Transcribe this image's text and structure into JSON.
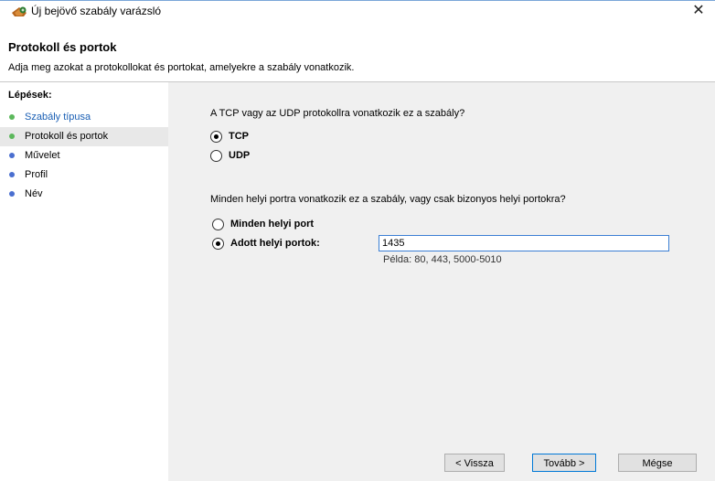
{
  "window": {
    "title": "Új bejövő szabály varázsló",
    "close_glyph": "✕",
    "icon": "firewall-wizard-icon"
  },
  "header": {
    "title": "Protokoll és portok",
    "subtitle": "Adja meg azokat a protokollokat és portokat, amelyekre a szabály vonatkozik."
  },
  "steps": {
    "title": "Lépések:",
    "items": [
      {
        "label": "Szabály típusa",
        "color": "#5cb85c"
      },
      {
        "label": "Protokoll és portok",
        "color": "#5cb85c"
      },
      {
        "label": "Művelet",
        "color": "#4a6fd0"
      },
      {
        "label": "Profil",
        "color": "#4a6fd0"
      },
      {
        "label": "Név",
        "color": "#4a6fd0"
      }
    ]
  },
  "protocol": {
    "question": "A TCP vagy az UDP protokollra vonatkozik ez a szabály?",
    "tcp": "TCP",
    "udp": "UDP",
    "selected": "TCP"
  },
  "ports": {
    "question": "Minden helyi portra vonatkozik ez a szabály, vagy csak bizonyos helyi portokra?",
    "all": "Minden helyi port",
    "specific": "Adott helyi portok:",
    "value": "1435",
    "example": "Példa: 80, 443, 5000-5010",
    "selected": "specific"
  },
  "buttons": {
    "back": "< Vissza",
    "next": "Tovább >",
    "cancel": "Mégse"
  }
}
